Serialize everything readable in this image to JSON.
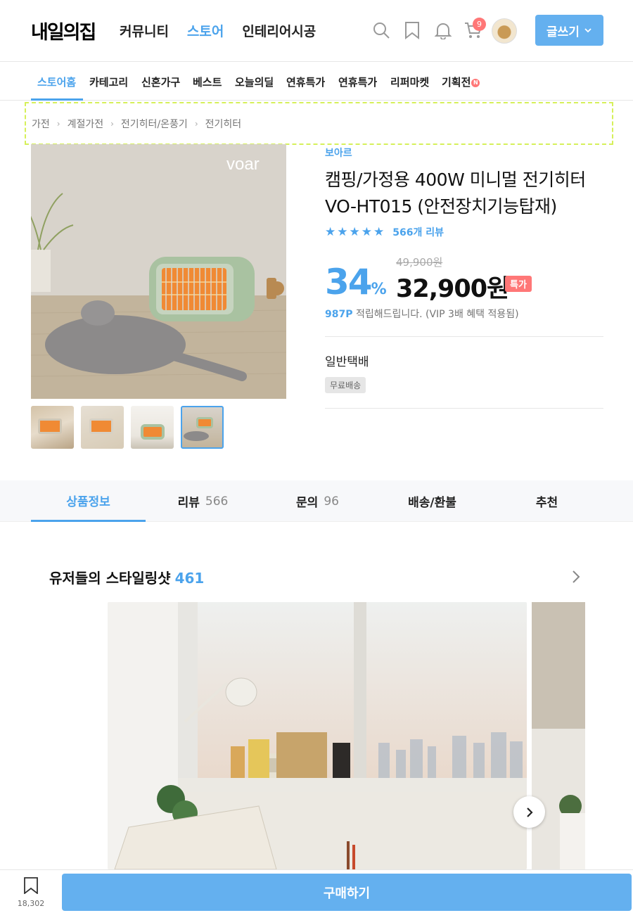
{
  "header": {
    "logo": "내일의집",
    "nav": [
      "커뮤니티",
      "스토어",
      "인테리어시공"
    ],
    "active_nav": "스토어",
    "cart_count": "9",
    "write_label": "글쓰기"
  },
  "subnav": {
    "items": [
      "스토어홈",
      "카테고리",
      "신혼가구",
      "베스트",
      "오늘의딜",
      "연휴특가",
      "연휴특가",
      "리퍼마켓",
      "기획전"
    ],
    "new_badge": "N"
  },
  "breadcrumb": [
    "가전",
    "계절가전",
    "전기히터/온풍기",
    "전기히터"
  ],
  "product": {
    "image_logo": "voar",
    "brand": "보아르",
    "title": "캠핑/가정용 400W 미니멀 전기히터 VO-HT015 (안전장치기능탑재)",
    "stars": 5,
    "review_count_label": "566개 리뷰",
    "discount_rate": "34",
    "discount_unit": "%",
    "original_price": "49,900",
    "original_unit": "원",
    "price": "32,900원",
    "special_badge": "특가",
    "points": "987P",
    "points_text": "적립해드립니다. (VIP 3배 혜택 적용됨)",
    "shipping_title": "일반택배",
    "shipping_badge": "무료배송"
  },
  "tabs": [
    {
      "label": "상품정보",
      "count": ""
    },
    {
      "label": "리뷰",
      "count": "566"
    },
    {
      "label": "문의",
      "count": "96"
    },
    {
      "label": "배송/환불",
      "count": ""
    },
    {
      "label": "추천",
      "count": ""
    }
  ],
  "styling": {
    "title": "유저들의 스타일링샷",
    "count": "461"
  },
  "bottom": {
    "bookmark_count": "18,302",
    "buy_label": "구매하기"
  },
  "colors": {
    "accent": "#4ba3ec",
    "button": "#64b0ef",
    "badge": "#ff7777"
  }
}
